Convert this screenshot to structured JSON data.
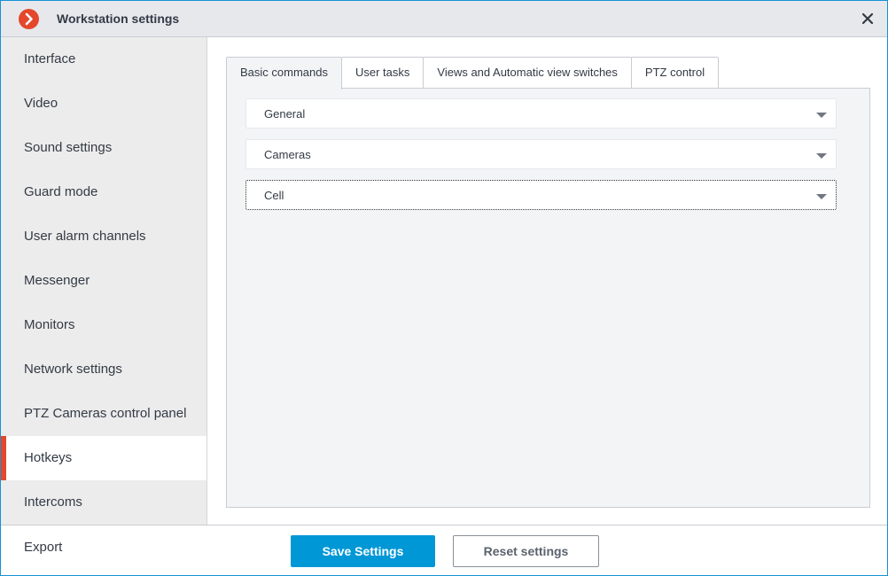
{
  "window": {
    "title": "Workstation settings",
    "logo_icon": "chevron-right-icon",
    "close_icon": "close-icon"
  },
  "sidebar": {
    "items": [
      {
        "label": "Interface",
        "active": false
      },
      {
        "label": "Video",
        "active": false
      },
      {
        "label": "Sound settings",
        "active": false
      },
      {
        "label": "Guard mode",
        "active": false
      },
      {
        "label": "User alarm channels",
        "active": false
      },
      {
        "label": "Messenger",
        "active": false
      },
      {
        "label": "Monitors",
        "active": false
      },
      {
        "label": "Network settings",
        "active": false
      },
      {
        "label": "PTZ Cameras control panel",
        "active": false
      },
      {
        "label": "Hotkeys",
        "active": true
      },
      {
        "label": "Intercoms",
        "active": false
      }
    ],
    "export_label": "Export",
    "accent_color": "#e4472b"
  },
  "tabs": [
    {
      "label": "Basic commands",
      "active": true
    },
    {
      "label": "User tasks",
      "active": false
    },
    {
      "label": "Views and Automatic view switches",
      "active": false
    },
    {
      "label": "PTZ control",
      "active": false
    }
  ],
  "sections": [
    {
      "label": "General",
      "focused": false
    },
    {
      "label": "Cameras",
      "focused": false
    },
    {
      "label": "Cell",
      "focused": true
    }
  ],
  "footer": {
    "save_label": "Save Settings",
    "reset_label": "Reset settings",
    "save_color": "#0097d6"
  }
}
